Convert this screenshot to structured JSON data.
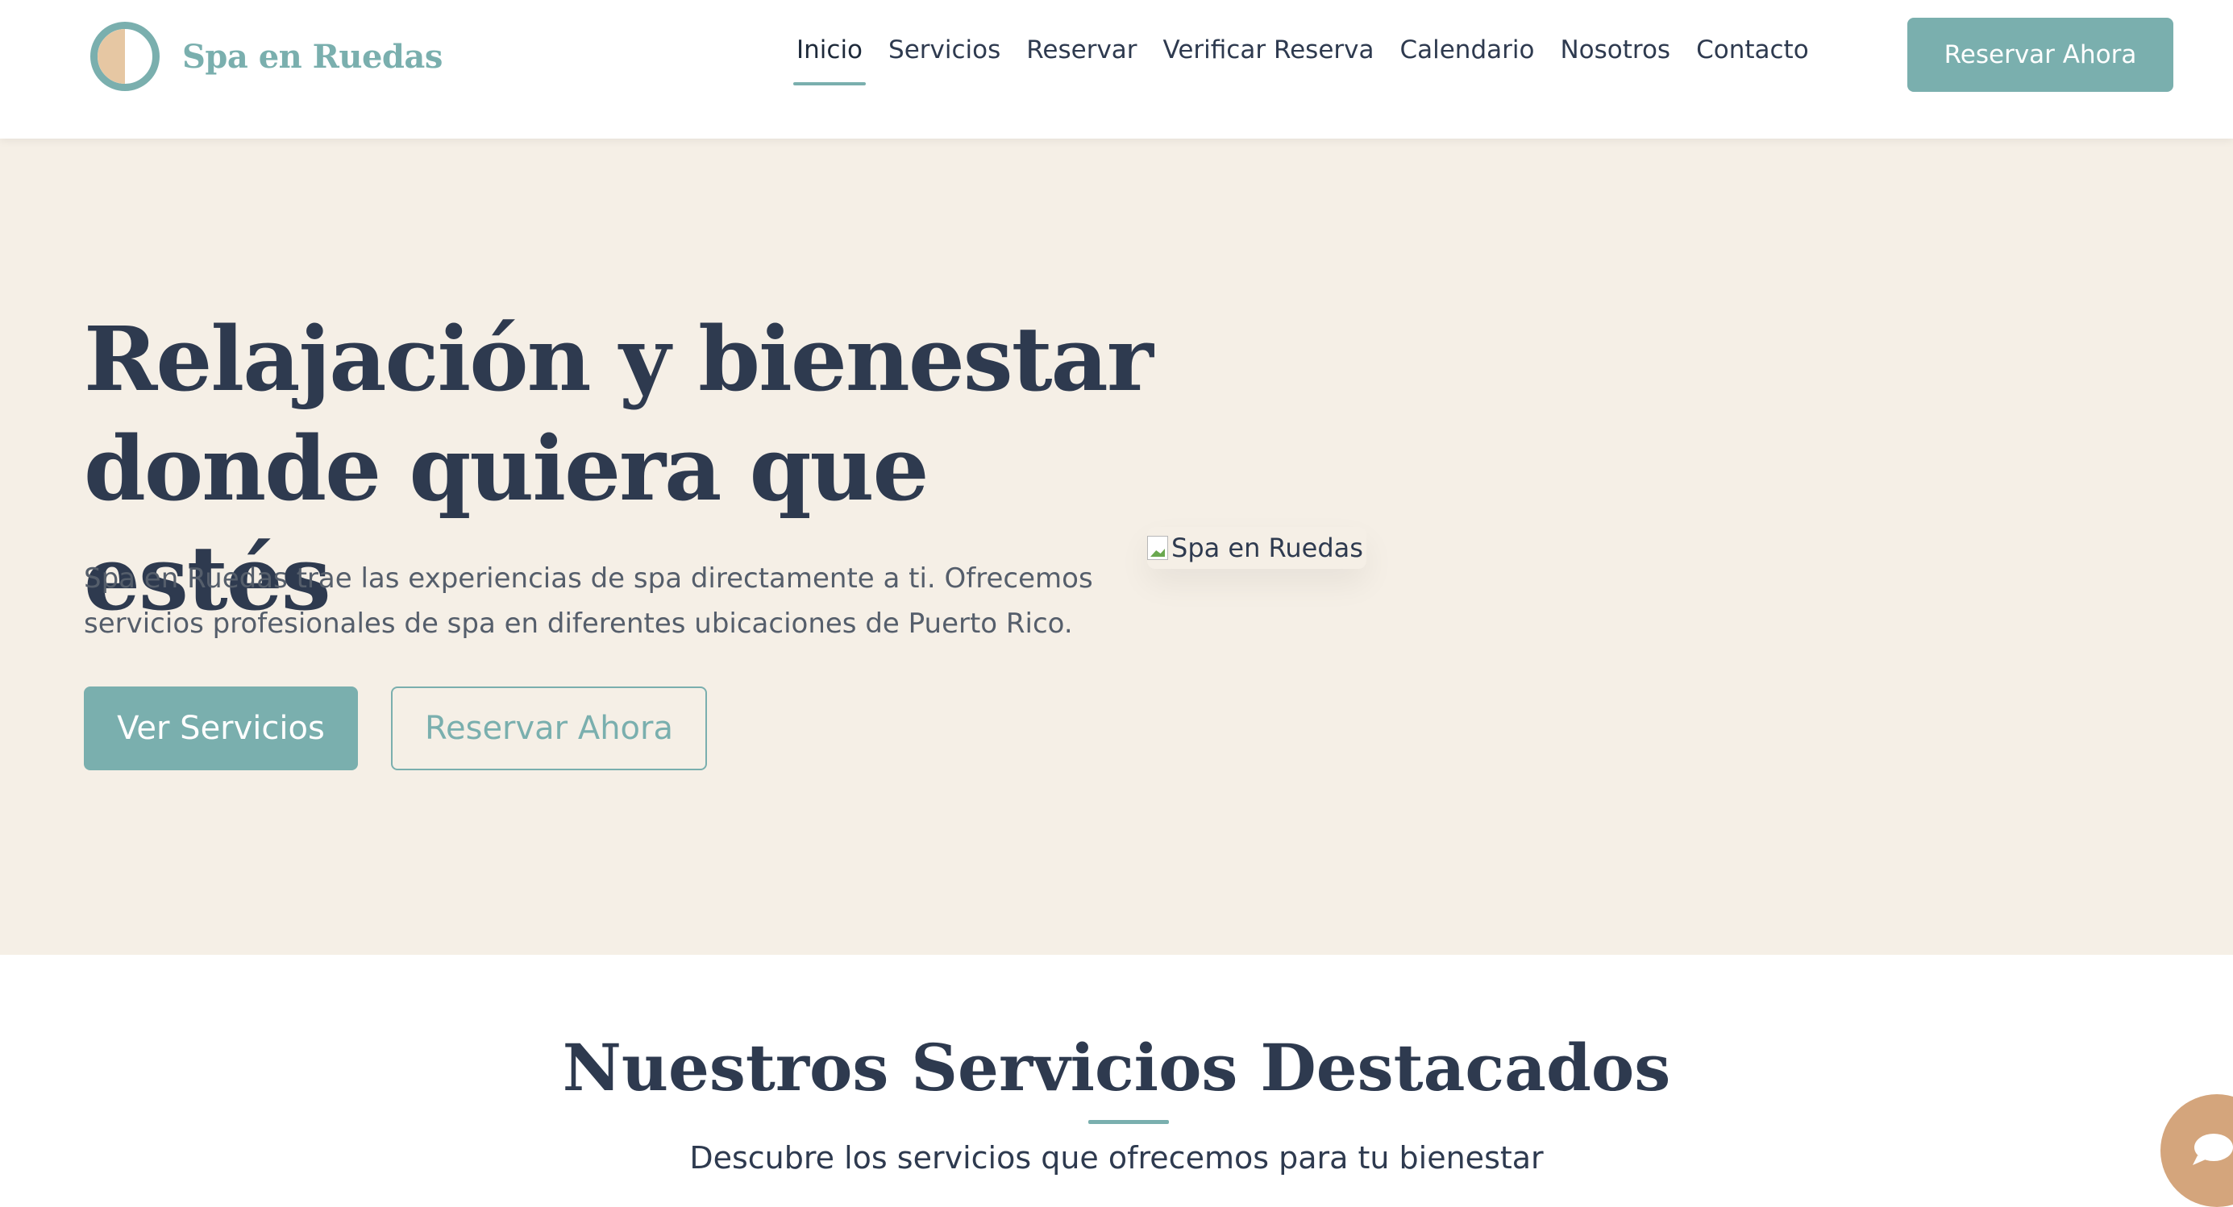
{
  "brand": {
    "name": "Spa en Ruedas",
    "colors": {
      "accent": "#7aafae",
      "sand": "#e6c7a3",
      "hero_bg": "#f5efe6",
      "text_dark": "#2e3a4f",
      "chat": "#d4a57c"
    }
  },
  "header": {
    "nav": [
      {
        "label": "Inicio",
        "active": true
      },
      {
        "label": "Servicios",
        "active": false
      },
      {
        "label": "Reservar",
        "active": false
      },
      {
        "label": "Verificar Reserva",
        "active": false
      },
      {
        "label": "Calendario",
        "active": false
      },
      {
        "label": "Nosotros",
        "active": false
      },
      {
        "label": "Contacto",
        "active": false
      }
    ],
    "cta_label": "Reservar Ahora"
  },
  "hero": {
    "title_line1": "Relajación y bienestar",
    "title_line2": "donde quiera que estés",
    "description": "Spa en Ruedas trae las experiencias de spa directamente a ti. Ofrecemos servicios profesionales de spa en diferentes ubicaciones de Puerto Rico.",
    "primary_button": "Ver Servicios",
    "secondary_button": "Reservar Ahora",
    "image_alt": "Spa en Ruedas"
  },
  "services": {
    "title": "Nuestros Servicios Destacados",
    "subtitle": "Descubre los servicios que ofrecemos para tu bienestar"
  },
  "chat": {
    "icon": "chat-bubble-icon"
  }
}
